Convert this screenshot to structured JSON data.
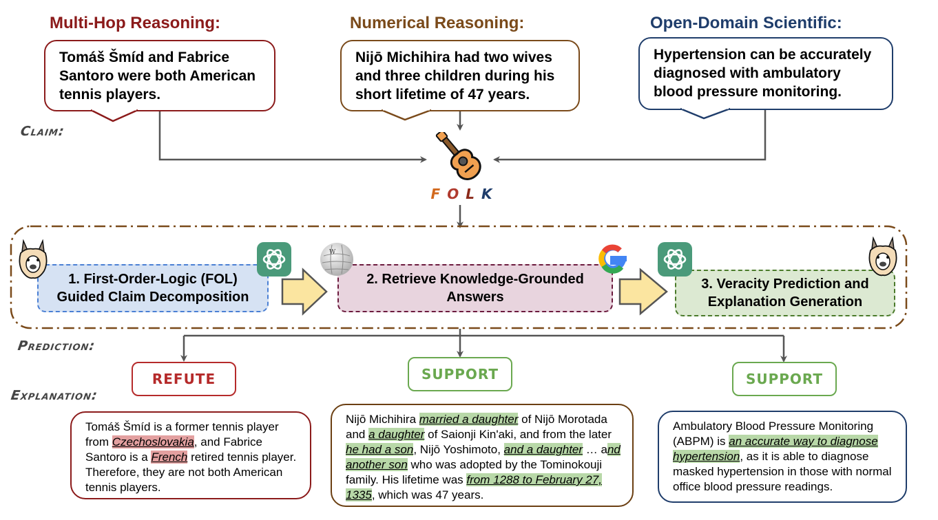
{
  "categories": [
    {
      "title": "Multi-Hop Reasoning:",
      "color": "#8b1a1a",
      "claim": "Tomáš Šmíd and Fabrice Santoro were both American tennis players."
    },
    {
      "title": "Numerical Reasoning:",
      "color": "#7a4a1a",
      "claim": "Nijō Michihira had two wives and three children during his short lifetime of 47 years."
    },
    {
      "title": "Open-Domain Scientific:",
      "color": "#1f3d6b",
      "claim": "Hypertension can be accurately diagnosed with ambulatory blood pressure monitoring."
    }
  ],
  "labels": {
    "claim": "Claim:",
    "prediction": "Prediction:",
    "explanation": "Explanation:"
  },
  "logo": {
    "icon": "guitar-icon",
    "letters": [
      {
        "char": "F",
        "color": "#d2691e"
      },
      {
        "char": "O",
        "color": "#b03a2e"
      },
      {
        "char": "L",
        "color": "#8b2a1a"
      },
      {
        "char": "K",
        "color": "#1f3d6b"
      }
    ]
  },
  "pipeline": {
    "border_color": "#7a4a1a",
    "stages": [
      {
        "label": "1. First-Order-Logic (FOL) Guided Claim Decomposition",
        "bg": "#d6e2f3",
        "border": "#4a7fd4",
        "icons": [
          "alpaca-icon",
          "chatgpt-icon"
        ]
      },
      {
        "label": "2. Retrieve Knowledge-Grounded Answers",
        "bg": "#e8d4de",
        "border": "#6b1a3d",
        "icons": [
          "wikipedia-icon",
          "google-icon"
        ]
      },
      {
        "label": "3. Veracity Prediction and Explanation Generation",
        "bg": "#dce9d2",
        "border": "#4a7a2a",
        "icons": [
          "chatgpt-icon",
          "alpaca-icon"
        ]
      }
    ]
  },
  "predictions": [
    {
      "verdict": "REFUTE",
      "color": "#b52a2a",
      "explanation_border": "#8b1a1a",
      "explanation": [
        {
          "t": "Tomáš Šmíd is a former tennis player from "
        },
        {
          "t": "Czechoslovakia",
          "hl": "red"
        },
        {
          "t": ", and Fabrice Santoro is a "
        },
        {
          "t": "French",
          "hl": "red"
        },
        {
          "t": " retired tennis player. Therefore, they are not both American tennis players."
        }
      ]
    },
    {
      "verdict": "SUPPORT",
      "color": "#6aa84f",
      "explanation_border": "#6b3f12",
      "explanation": [
        {
          "t": "Nijō Michihira "
        },
        {
          "t": "married a daughter",
          "hl": "green"
        },
        {
          "t": " of Nijō Morotada and "
        },
        {
          "t": "a daughter",
          "hl": "green"
        },
        {
          "t": " of Saionji Kin'aki, and from the later "
        },
        {
          "t": "he had a son",
          "hl": "green"
        },
        {
          "t": ", Nijō Yoshimoto, "
        },
        {
          "t": "and a daughter",
          "hl": "green"
        },
        {
          "t": " … a"
        },
        {
          "t": "nd another son",
          "hl": "green"
        },
        {
          "t": " who was adopted by the Tominokouji family. His lifetime was "
        },
        {
          "t": "from 1288 to February 27, 1335",
          "hl": "green"
        },
        {
          "t": ", which was 47 years."
        }
      ]
    },
    {
      "verdict": "SUPPORT",
      "color": "#6aa84f",
      "explanation_border": "#1f3d6b",
      "explanation": [
        {
          "t": "Ambulatory Blood Pressure Monitoring (ABPM) is "
        },
        {
          "t": "an accurate way to diagnose hypertension",
          "hl": "green"
        },
        {
          "t": ", as it is able to diagnose masked hypertension in those with normal office blood pressure readings."
        }
      ]
    }
  ]
}
